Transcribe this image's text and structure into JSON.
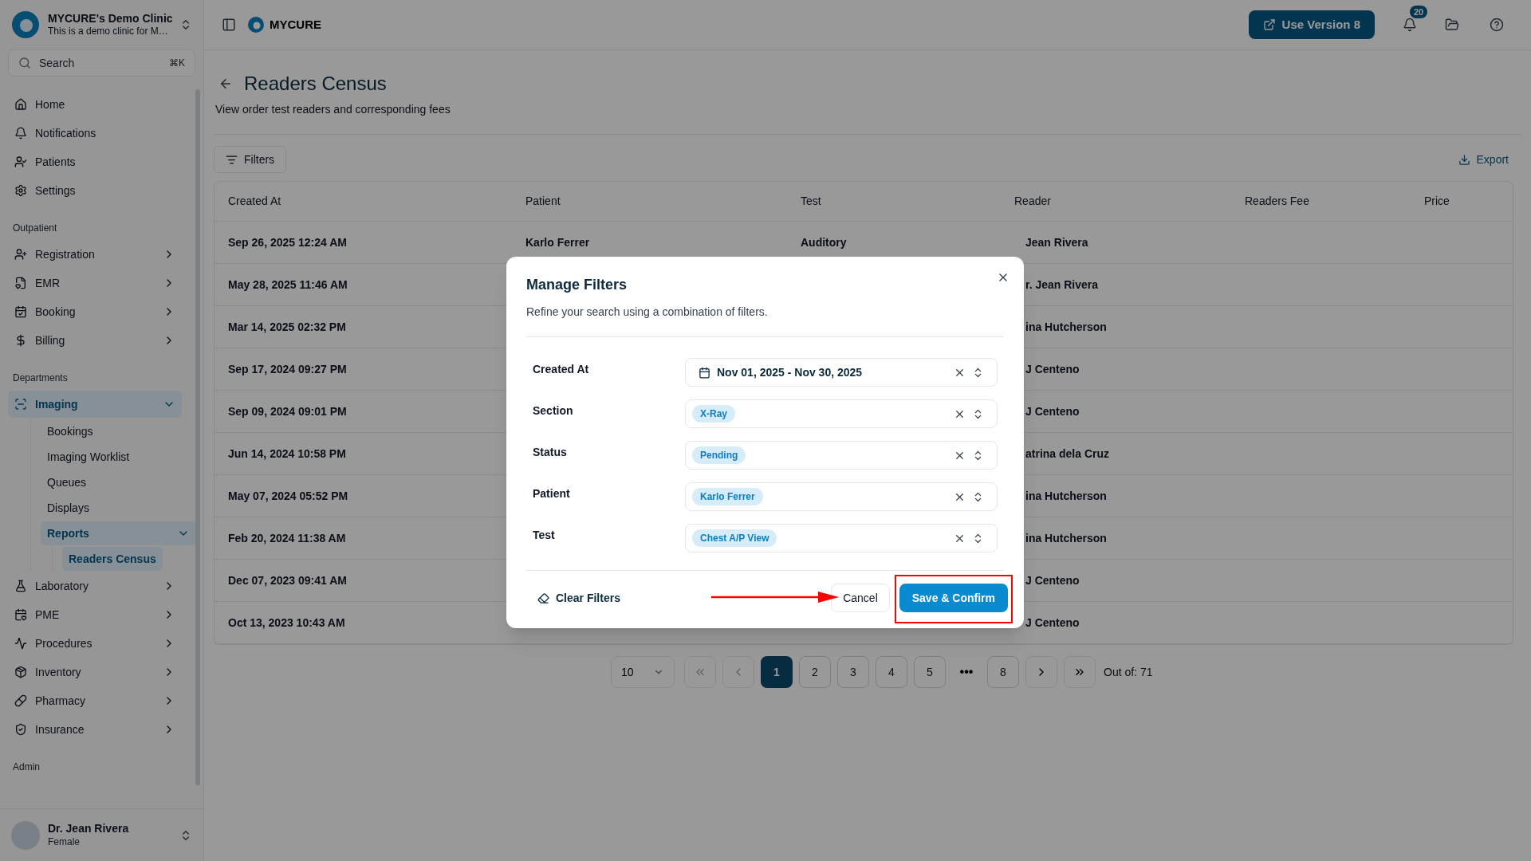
{
  "sidebar": {
    "clinic_name": "MYCURE's Demo Clinic",
    "clinic_subtitle": "This is a demo clinic for M…",
    "search": {
      "placeholder": "Search",
      "shortcut": "⌘K"
    },
    "groups": [
      {
        "items": [
          {
            "label": "Home",
            "selected": false
          },
          {
            "label": "Notifications",
            "selected": false
          },
          {
            "label": "Patients",
            "selected": false
          },
          {
            "label": "Settings",
            "selected": false
          }
        ]
      },
      {
        "heading": "Outpatient",
        "items": [
          {
            "label": "Registration",
            "selected": false,
            "expanded": false
          },
          {
            "label": "EMR",
            "selected": false,
            "expanded": false
          },
          {
            "label": "Booking",
            "selected": false,
            "expanded": false
          },
          {
            "label": "Billing",
            "selected": false,
            "expanded": false
          }
        ]
      },
      {
        "heading": "Departments",
        "items": [
          {
            "label": "Imaging",
            "selected": true,
            "expanded": true,
            "children": [
              {
                "label": "Bookings",
                "selected": false
              },
              {
                "label": "Imaging Worklist",
                "selected": false
              },
              {
                "label": "Queues",
                "selected": false
              },
              {
                "label": "Displays",
                "selected": false
              },
              {
                "label": "Reports",
                "selected": true,
                "expanded": true,
                "children": [
                  {
                    "label": "Readers Census",
                    "selected": true
                  }
                ]
              }
            ]
          },
          {
            "label": "Laboratory",
            "selected": false,
            "expanded": false
          },
          {
            "label": "PME",
            "selected": false,
            "expanded": false
          },
          {
            "label": "Procedures",
            "selected": false,
            "expanded": false
          },
          {
            "label": "Inventory",
            "selected": false,
            "expanded": false
          },
          {
            "label": "Pharmacy",
            "selected": false,
            "expanded": false
          },
          {
            "label": "Insurance",
            "selected": false,
            "expanded": false
          }
        ]
      },
      {
        "heading": "Admin"
      }
    ],
    "user": {
      "name": "Dr. Jean Rivera",
      "detail": "Female"
    }
  },
  "topbar": {
    "brand": "MYCURE",
    "version_button": "Use Version 8",
    "notification_count": "20"
  },
  "page": {
    "title": "Readers Census",
    "subtitle": "View order test readers and corresponding fees",
    "filters_button": "Filters",
    "export_button": "Export"
  },
  "table": {
    "columns": [
      "Created At",
      "Patient",
      "Test",
      "Reader",
      "Readers Fee",
      "Price"
    ],
    "rows": [
      {
        "created_at": "Sep 26, 2025 12:24 AM",
        "patient": "Karlo Ferrer",
        "test": "Auditory",
        "reader": "Jean Rivera"
      },
      {
        "created_at": "May 28, 2025 11:46 AM",
        "reader": "r. Jean Rivera"
      },
      {
        "created_at": "Mar 14, 2025 02:32 PM",
        "reader": "ina Hutcherson"
      },
      {
        "created_at": "Sep 17, 2024 09:27 PM",
        "reader": "J Centeno"
      },
      {
        "created_at": "Sep 09, 2024 09:01 PM",
        "reader": "J Centeno"
      },
      {
        "created_at": "Jun 14, 2024 10:58 PM",
        "reader": "atrina dela Cruz"
      },
      {
        "created_at": "May 07, 2024 05:52 PM",
        "reader": "ina Hutcherson"
      },
      {
        "created_at": "Feb 20, 2024 11:38 AM",
        "reader": "ina Hutcherson"
      },
      {
        "created_at": "Dec 07, 2023 09:41 AM",
        "reader": "J Centeno"
      },
      {
        "created_at": "Oct 13, 2023 10:43 AM",
        "reader": "J Centeno"
      }
    ]
  },
  "pagination": {
    "page_size": "10",
    "pages": [
      {
        "label": "1",
        "selected": true
      },
      {
        "label": "2",
        "selected": false
      },
      {
        "label": "3",
        "selected": false
      },
      {
        "label": "4",
        "selected": false
      },
      {
        "label": "5",
        "selected": false
      },
      {
        "label": "•••",
        "kind": "gap"
      },
      {
        "label": "8",
        "selected": false
      }
    ],
    "total": "Out of: 71"
  },
  "modal": {
    "title": "Manage Filters",
    "description": "Refine your search using a combination of filters.",
    "filters": [
      {
        "label": "Created At",
        "kind": "date",
        "value": "Nov 01, 2025 - Nov 30, 2025"
      },
      {
        "label": "Section",
        "kind": "chips",
        "chips": [
          "X-Ray"
        ]
      },
      {
        "label": "Status",
        "kind": "chips",
        "chips": [
          "Pending"
        ]
      },
      {
        "label": "Patient",
        "kind": "chips",
        "chips": [
          "Karlo Ferrer"
        ]
      },
      {
        "label": "Test",
        "kind": "chips",
        "chips": [
          "Chest A/P View"
        ]
      }
    ],
    "clear_button": "Clear Filters",
    "cancel_button": "Cancel",
    "confirm_button": "Save & Confirm"
  }
}
